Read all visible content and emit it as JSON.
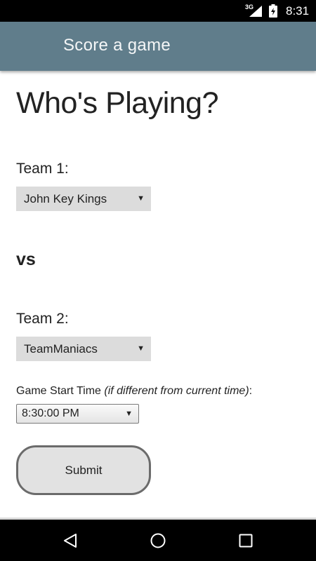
{
  "status_bar": {
    "network": "3G",
    "time": "8:31",
    "icons": [
      "signal-icon",
      "battery-charging-icon"
    ]
  },
  "app_bar": {
    "title": "Score a game"
  },
  "form": {
    "heading": "Who's Playing?",
    "team1": {
      "label": "Team 1:",
      "selected": "John Key Kings"
    },
    "vs": "vs",
    "team2": {
      "label": "Team 2:",
      "selected": "TeamManiacs"
    },
    "start_time": {
      "label": "Game Start Time ",
      "label_note": "(if different from current time)",
      "label_suffix": ":",
      "selected": "8:30:00 PM"
    },
    "submit_label": "Submit"
  },
  "nav_bar": {
    "icons": [
      "back-icon",
      "home-icon",
      "recents-icon"
    ]
  },
  "colors": {
    "app_bar": "#607d8b",
    "status_bar": "#000000",
    "select_bg": "#dcdcdc",
    "button_bg": "#e2e2e2"
  }
}
